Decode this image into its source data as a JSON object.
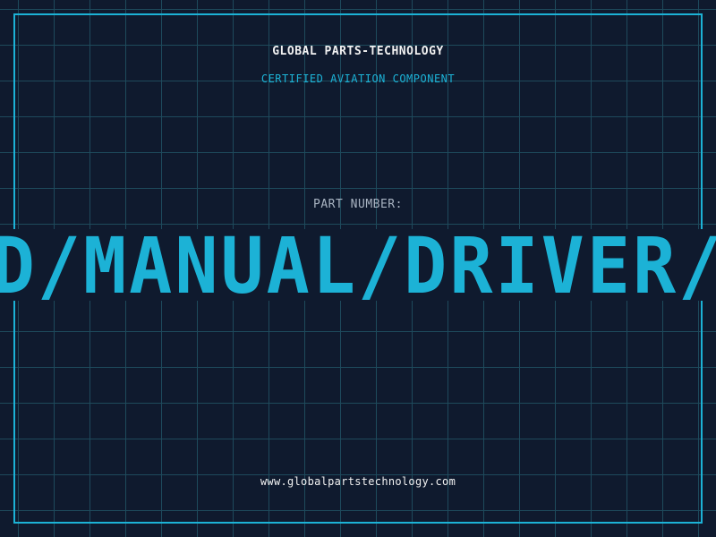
{
  "label": {
    "company": "GLOBAL PARTS-TECHNOLOGY",
    "subtitle": "CERTIFIED AVIATION COMPONENT",
    "part_number_label": "PART NUMBER:",
    "part_number": "CD/MANUAL/DRIVER/C",
    "website": "www.globalpartstechnology.com"
  },
  "colors": {
    "background": "#0f1a2e",
    "grid": "#1e4a5c",
    "accent": "#1cb2d6",
    "text_primary": "#f2f2f2",
    "text_muted": "#a9b4c2"
  }
}
